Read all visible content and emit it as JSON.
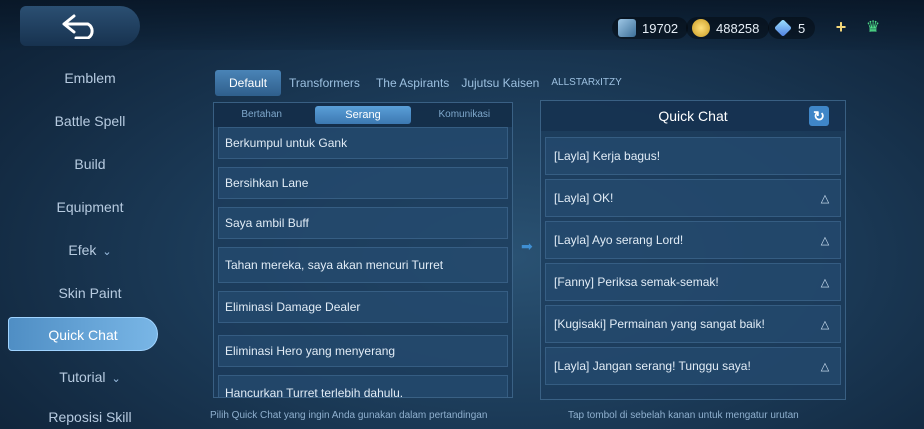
{
  "currencies": [
    {
      "icon": "ticket-icon",
      "value": "19702"
    },
    {
      "icon": "gold-coin-icon",
      "value": "488258"
    },
    {
      "icon": "diamond-icon",
      "value": "5"
    }
  ],
  "sidebar": {
    "items": [
      {
        "label": "Emblem",
        "chevron": ""
      },
      {
        "label": "Battle Spell",
        "chevron": ""
      },
      {
        "label": "Build",
        "chevron": ""
      },
      {
        "label": "Equipment",
        "chevron": ""
      },
      {
        "label": "Efek",
        "chevron": "⌄"
      },
      {
        "label": "Skin Paint",
        "chevron": ""
      },
      {
        "label": "Quick Chat",
        "chevron": ""
      },
      {
        "label": "Tutorial",
        "chevron": "⌄"
      },
      {
        "label": "Reposisi Skill",
        "chevron": ""
      }
    ]
  },
  "tabs": [
    "Default",
    "Transformers",
    "The Aspirants",
    "Jujutsu Kaisen",
    "ALLSTARxITZY"
  ],
  "subtabs": [
    "Bertahan",
    "Serang",
    "Komunikasi"
  ],
  "options": [
    "Berkumpul untuk Gank",
    "Bersihkan Lane",
    "Saya ambil Buff",
    "Tahan mereka, saya akan mencuri Turret",
    "Eliminasi Damage Dealer",
    "Eliminasi Hero yang menyerang",
    "Hancurkan Turret terlebih dahulu."
  ],
  "quick_chat": {
    "title": "Quick Chat",
    "rows": [
      "[Layla] Kerja bagus!",
      "[Layla] OK!",
      "[Layla] Ayo serang Lord!",
      "[Fanny] Periksa semak-semak!",
      "[Kugisaki] Permainan yang sangat baik!",
      "[Layla] Jangan serang! Tunggu saya!"
    ]
  },
  "hints": {
    "left": "Pilih Quick Chat yang ingin Anda gunakan dalam pertandingan",
    "right": "Tap tombol di sebelah kanan untuk mengatur urutan"
  },
  "colors": {
    "accent": "#3f86c8",
    "active_tab": "#4a84b7"
  }
}
